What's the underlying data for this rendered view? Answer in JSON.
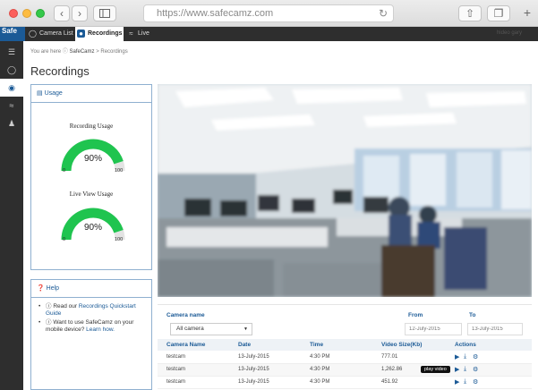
{
  "browser": {
    "url": "https://www.safecamz.com",
    "back_icon": "chevron-left-icon",
    "forward_icon": "chevron-right-icon"
  },
  "appbar": {
    "logo": "Safe",
    "tabs": [
      {
        "label": "Camera List",
        "icon": "camera-icon"
      },
      {
        "label": "Recordings",
        "icon": "recordings-icon"
      },
      {
        "label": "Live",
        "icon": "live-icon"
      }
    ],
    "user": "hideo gary"
  },
  "breadcrumb": {
    "prefix": "You are here",
    "home": "SafeCamz",
    "current": "Recordings"
  },
  "page_title": "Recordings",
  "usage": {
    "header": "Usage",
    "recording": {
      "label": "Recording Usage",
      "value": "90%",
      "level": 0.9,
      "min": "0",
      "max": "100"
    },
    "live": {
      "label": "Live View Usage",
      "value": "90%",
      "level": 0.9,
      "min": "0",
      "max": "100"
    }
  },
  "help": {
    "header": "Help",
    "item1_prefix": "Read our ",
    "item1_link": "Recordings Quickstart Guide",
    "item2_prefix": "Want to use SafeCamz on your mobile device? ",
    "item2_link": "Learn how."
  },
  "filters": {
    "camera_label": "Camera name",
    "camera_value": "All camera",
    "from_label": "From",
    "from_placeholder": "12-July-2015",
    "to_label": "To",
    "to_placeholder": "13-July-2015"
  },
  "table": {
    "headers": [
      "Camera Name",
      "Date",
      "Time",
      "Video Size(Kb)",
      "Actions"
    ],
    "rows": [
      {
        "camera": "testcam",
        "date": "13-July-2015",
        "time": "4:30 PM",
        "size": "777.01"
      },
      {
        "camera": "testcam",
        "date": "13-July-2015",
        "time": "4:30 PM",
        "size": "1,262.86"
      },
      {
        "camera": "testcam",
        "date": "13-July-2015",
        "time": "4:30 PM",
        "size": "451.92"
      }
    ],
    "tooltip": "play video"
  },
  "colors": {
    "accent": "#1b5a96",
    "gauge_fill": "#1fc44f",
    "gauge_track": "#e3e3e3"
  }
}
